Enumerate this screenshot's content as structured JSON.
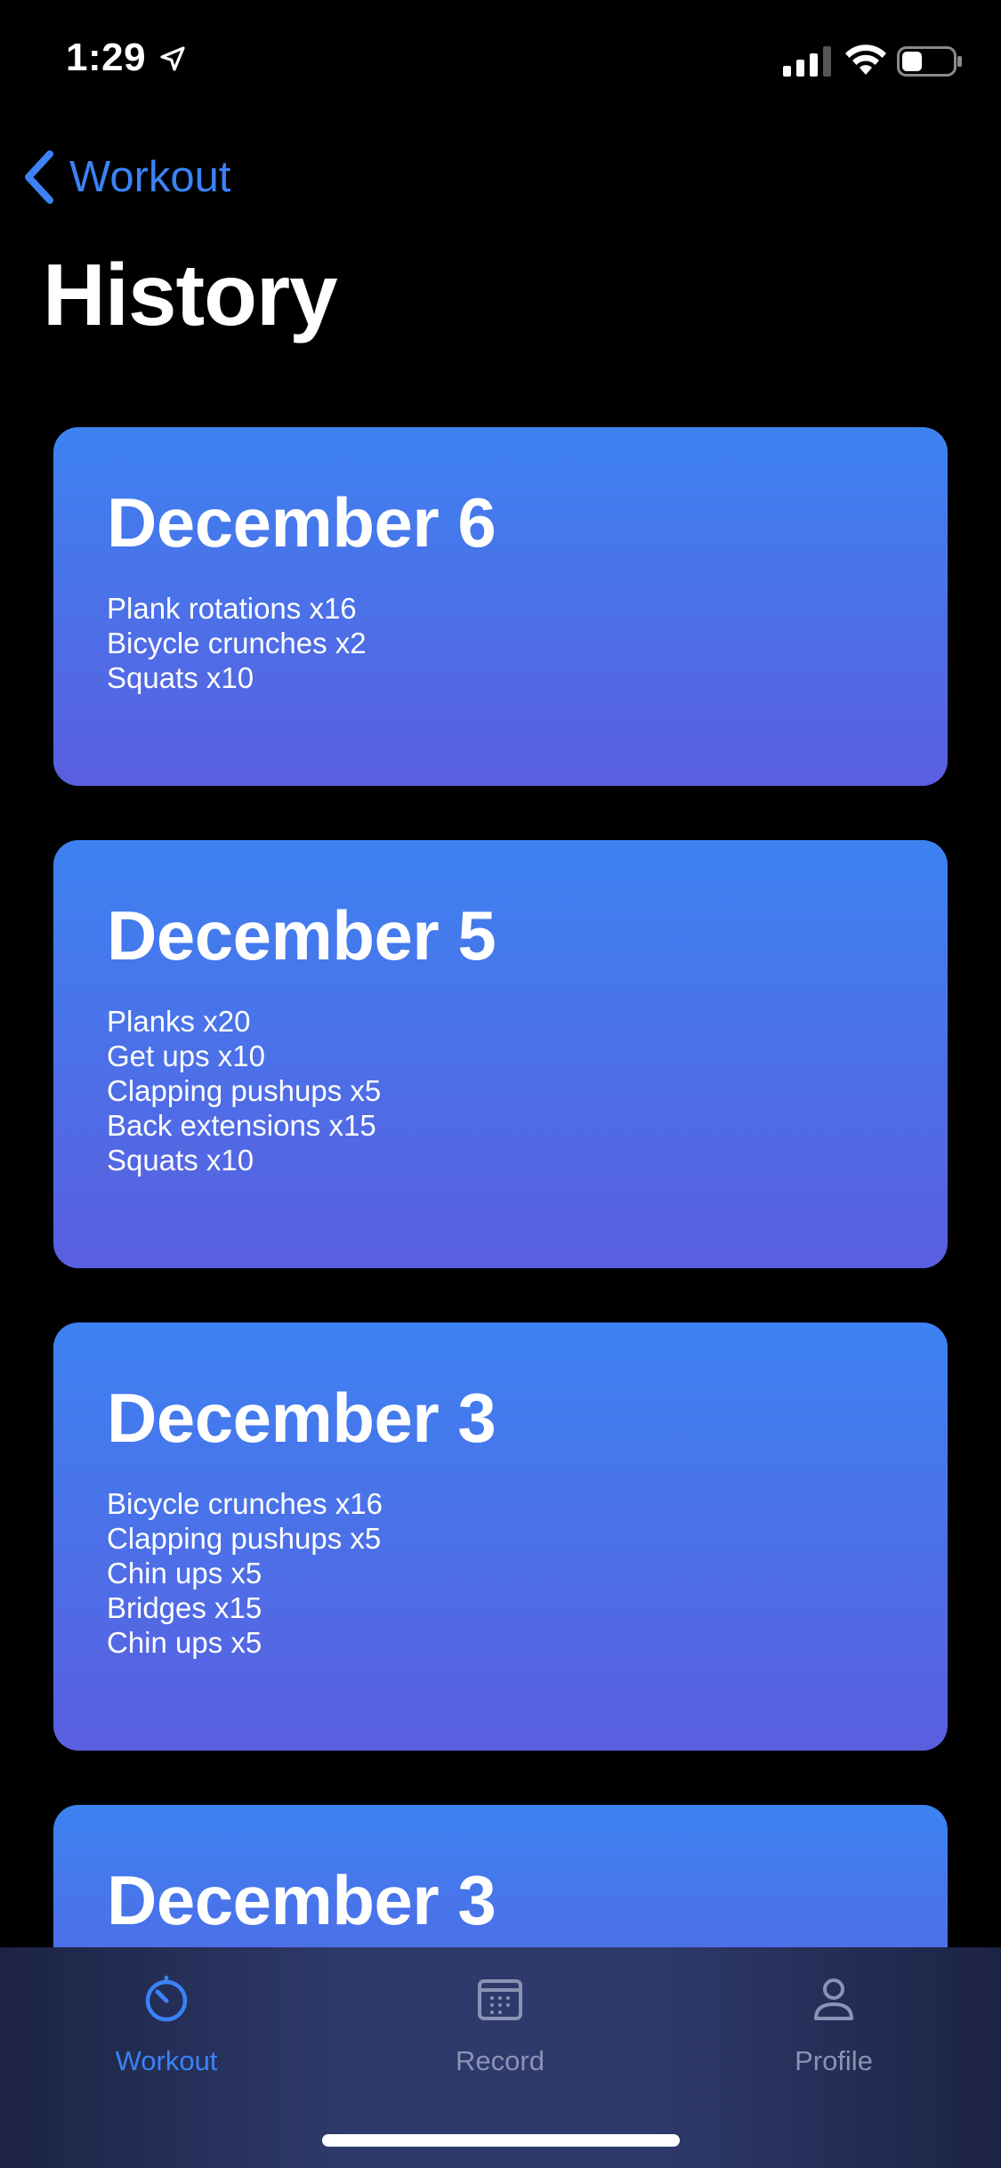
{
  "status_bar": {
    "time": "1:29"
  },
  "nav": {
    "back_label": "Workout",
    "title": "History"
  },
  "history": [
    {
      "date": "December 6",
      "exercises": [
        "Plank rotations x16",
        "Bicycle crunches x2",
        "Squats x10"
      ]
    },
    {
      "date": "December 5",
      "exercises": [
        "Planks x20",
        "Get ups x10",
        "Clapping pushups x5",
        "Back extensions x15",
        "Squats x10"
      ]
    },
    {
      "date": "December 3",
      "exercises": [
        "Bicycle crunches x16",
        "Clapping pushups x5",
        "Chin ups x5",
        "Bridges x15",
        "Chin ups x5"
      ]
    },
    {
      "date": "December 3",
      "exercises": []
    }
  ],
  "tab_bar": {
    "tabs": [
      {
        "label": "Workout",
        "icon": "stopwatch-icon",
        "active": true
      },
      {
        "label": "Record",
        "icon": "calendar-icon",
        "active": false
      },
      {
        "label": "Profile",
        "icon": "person-icon",
        "active": false
      }
    ]
  },
  "colors": {
    "accent": "#3b82f6",
    "card_gradient_top": "#3d82f1",
    "card_gradient_bottom": "#5a5fdf",
    "tab_inactive": "#8a93b3"
  }
}
